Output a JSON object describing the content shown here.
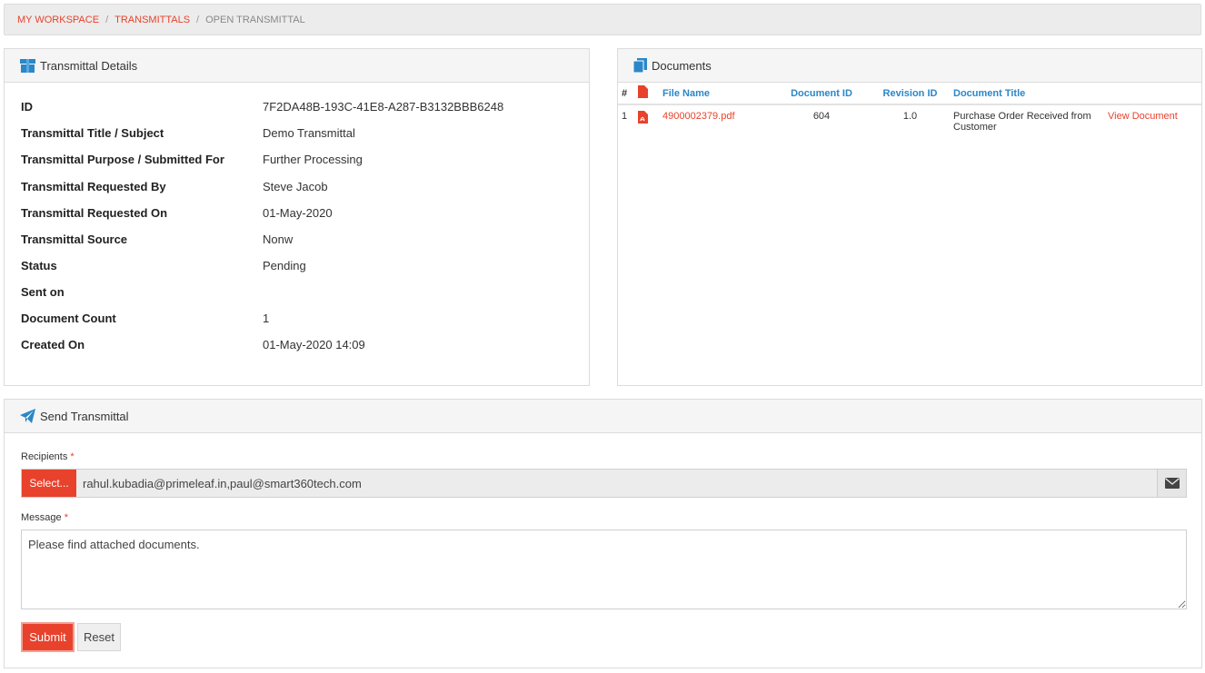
{
  "breadcrumb": {
    "items": [
      "MY WORKSPACE",
      "TRANSMITTALS"
    ],
    "current": "OPEN TRANSMITTAL",
    "separator": "/"
  },
  "details": {
    "title": "Transmittal Details",
    "icon": "box-icon",
    "rows": [
      {
        "label": "ID",
        "value": "7F2DA48B-193C-41E8-A287-B3132BBB6248"
      },
      {
        "label": "Transmittal Title / Subject",
        "value": "Demo Transmittal"
      },
      {
        "label": "Transmittal Purpose / Submitted For",
        "value": "Further Processing"
      },
      {
        "label": "Transmittal Requested By",
        "value": "Steve Jacob"
      },
      {
        "label": "Transmittal Requested On",
        "value": "01-May-2020"
      },
      {
        "label": "Transmittal Source",
        "value": "Nonw"
      },
      {
        "label": "Status",
        "value": "Pending"
      },
      {
        "label": "Sent on",
        "value": ""
      },
      {
        "label": "Document Count",
        "value": "1"
      },
      {
        "label": "Created On",
        "value": "01-May-2020 14:09"
      }
    ]
  },
  "documents": {
    "title": "Documents",
    "icon": "files-icon",
    "columns": {
      "num": "#",
      "file_name": "File Name",
      "document_id": "Document ID",
      "revision_id": "Revision ID",
      "document_title": "Document Title"
    },
    "rows": [
      {
        "num": "1",
        "file_name": "4900002379.pdf",
        "document_id": "604",
        "revision_id": "1.0",
        "document_title": "Purchase Order Received from Customer",
        "action": "View Document"
      }
    ]
  },
  "send": {
    "title": "Send Transmittal",
    "icon": "paper-plane-icon",
    "recipients_label": "Recipients",
    "required_mark": "*",
    "select_label": "Select...",
    "recipients_value": "rahul.kubadia@primeleaf.in,paul@smart360tech.com",
    "message_label": "Message",
    "message_value": "Please find attached documents.",
    "submit_label": "Submit",
    "reset_label": "Reset"
  },
  "colors": {
    "accent": "#e8422c",
    "link_blue": "#2a87c8",
    "header_bg": "#f5f5f5"
  }
}
